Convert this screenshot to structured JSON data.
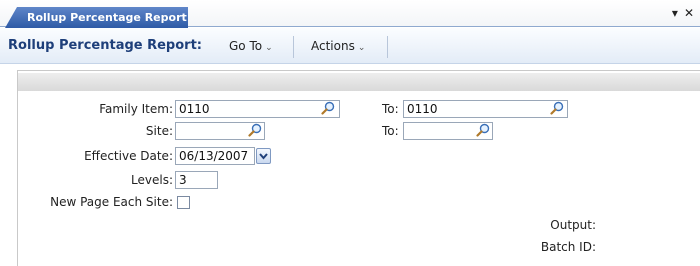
{
  "tab": {
    "label": "Rollup Percentage Report",
    "controls": "▾ ✕"
  },
  "menubar": {
    "title": "Rollup Percentage Report:",
    "goto": "Go To",
    "actions": "Actions"
  },
  "form": {
    "family_item": {
      "label": "Family Item:",
      "value": "0110",
      "to_label": "To:",
      "to_value": "0110"
    },
    "site": {
      "label": "Site:",
      "value": "",
      "to_label": "To:",
      "to_value": ""
    },
    "effective_date": {
      "label": "Effective Date:",
      "value": "06/13/2007"
    },
    "levels": {
      "label": "Levels:",
      "value": "3"
    },
    "new_page_each_site": {
      "label": "New Page Each Site:",
      "checked": false
    },
    "output": {
      "label": "Output:"
    },
    "batch_id": {
      "label": "Batch ID:"
    }
  }
}
